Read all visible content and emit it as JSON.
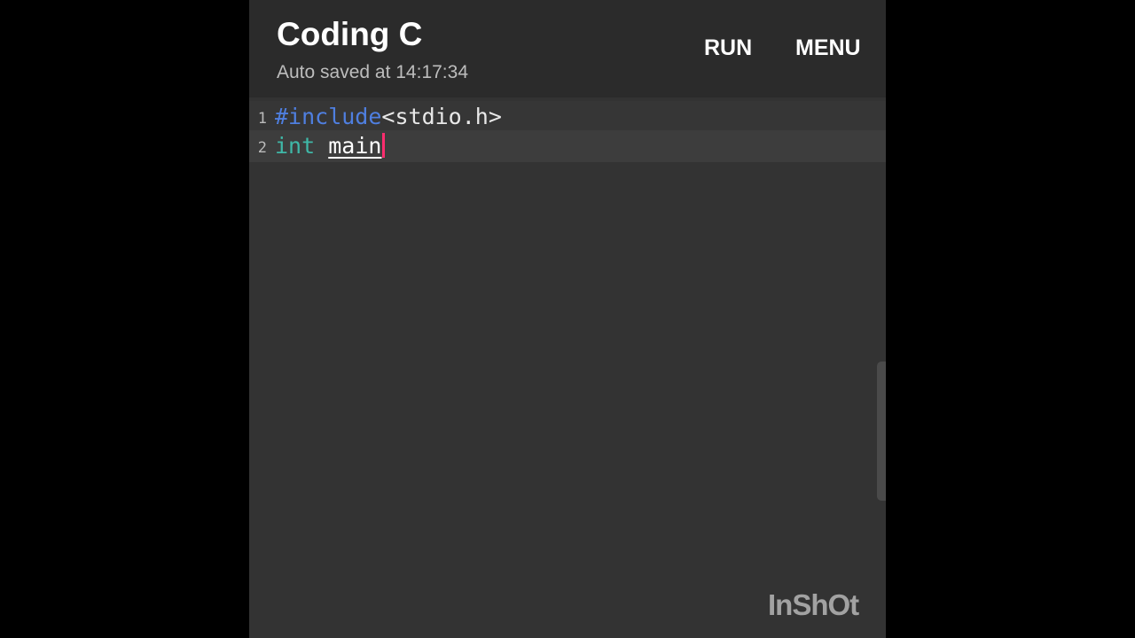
{
  "app": {
    "title": "Coding C",
    "subtitle": "Auto saved at 14:17:34",
    "actions": {
      "run_label": "RUN",
      "menu_label": "MENU"
    }
  },
  "editor": {
    "lines": [
      {
        "number": "1",
        "tokens": {
          "directive": "#include",
          "header": "<stdio.h>"
        }
      },
      {
        "number": "2",
        "tokens": {
          "keyword": "int",
          "space": " ",
          "ident": "main"
        }
      }
    ],
    "caret_color": "#ff2d6e",
    "colors": {
      "directive": "#4f7fe0",
      "keyword": "#3fb8a8",
      "text": "#e8e8e8"
    }
  },
  "watermark": "InShOt"
}
